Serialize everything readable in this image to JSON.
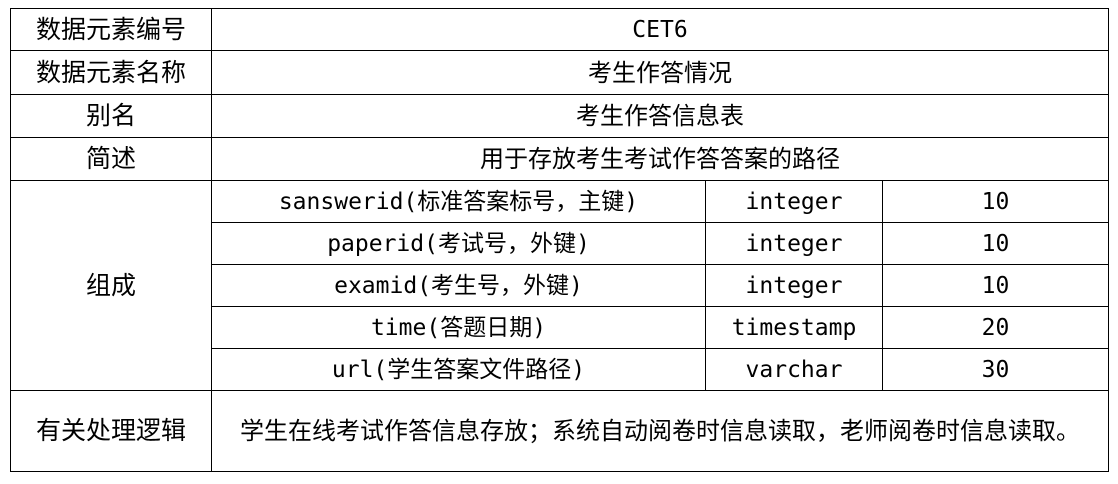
{
  "rows": {
    "id": {
      "label": "数据元素编号",
      "value": "CET6"
    },
    "name": {
      "label": "数据元素名称",
      "value": "考生作答情况"
    },
    "alias": {
      "label": "别名",
      "value": "考生作答信息表"
    },
    "description": {
      "label": "简述",
      "value": "用于存放考生考试作答答案的路径"
    },
    "composition": {
      "label": "组成",
      "fields": [
        {
          "name": "sanswerid(标准答案标号，主键)",
          "type": "integer",
          "length": "10"
        },
        {
          "name": "paperid(考试号，外键)",
          "type": "integer",
          "length": "10"
        },
        {
          "name": "examid(考生号，外键)",
          "type": "integer",
          "length": "10"
        },
        {
          "name": "time(答题日期)",
          "type": "timestamp",
          "length": "20"
        },
        {
          "name": "url(学生答案文件路径)",
          "type": "varchar",
          "length": "30"
        }
      ]
    },
    "logic": {
      "label": "有关处理逻辑",
      "value": "学生在线考试作答信息存放；系统自动阅卷时信息读取，老师阅卷时信息读取。"
    }
  }
}
